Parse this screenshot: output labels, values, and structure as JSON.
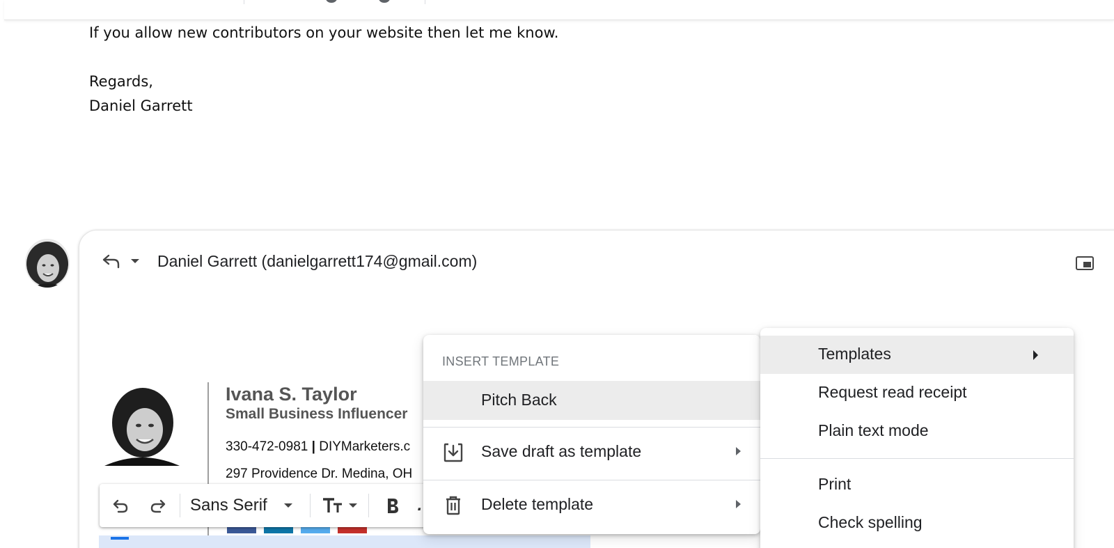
{
  "message": {
    "lines": [
      "If you allow new contributors on your website then let me know.",
      "",
      "Regards,",
      "Daniel Garrett"
    ]
  },
  "compose": {
    "recipient": "Daniel Garrett (danielgarrett174@gmail.com)"
  },
  "signature": {
    "name": "Ivana S. Taylor",
    "role": "Small Business Influencer",
    "phone": "330-472-0981",
    "separator": "|",
    "website": "DIYMarketers.c",
    "address": "297 Providence Dr. Medina, OH",
    "social_colors": [
      "#3b5998",
      "#0e76a8",
      "#55acee",
      "#c4302b"
    ]
  },
  "format_toolbar": {
    "font": "Sans Serif"
  },
  "template_menu": {
    "header": "INSERT TEMPLATE",
    "items": [
      {
        "label": "Pitch Back",
        "icon": "none",
        "highlighted": true
      },
      {
        "label": "Save draft as template",
        "icon": "save-template-icon",
        "submenu": true
      },
      {
        "label": "Delete template",
        "icon": "trash-icon",
        "submenu": true
      }
    ]
  },
  "more_menu": {
    "items": [
      {
        "label": "Templates",
        "highlighted": true,
        "submenu": true
      },
      {
        "label": "Request read receipt"
      },
      {
        "label": "Plain text mode"
      },
      {
        "label": "Print"
      },
      {
        "label": "Check spelling"
      }
    ]
  },
  "colors": {
    "highlight": "#ececec",
    "signature_gray": "#555555",
    "selection_blue": "#dce7f9"
  }
}
